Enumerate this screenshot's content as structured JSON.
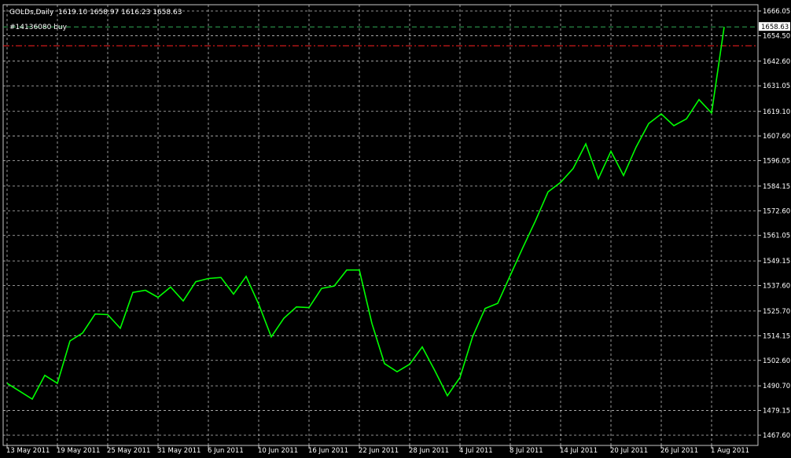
{
  "header": {
    "symbol_label": "GOLDs,Daily",
    "ohlc_text": "1619.10 1658.97 1616.23 1658.63",
    "order_label": "#14136080 buy"
  },
  "colors": {
    "background": "#000000",
    "grid": "#ffffff",
    "price_line": "#00ff00",
    "current_price_line": "#33aa55",
    "order_line": "#ff2020",
    "text": "#ffffff",
    "price_box_bg": "#ffffff",
    "price_box_text": "#000000"
  },
  "chart_data": {
    "type": "line",
    "current_price": 1658.63,
    "order_price": 1649.8,
    "ylim": [
      1467.6,
      1666.05
    ],
    "y_ticks": [
      1666.05,
      1654.5,
      1642.6,
      1631.05,
      1619.1,
      1607.6,
      1596.05,
      1584.15,
      1572.6,
      1561.05,
      1549.15,
      1537.6,
      1525.7,
      1514.15,
      1502.6,
      1490.7,
      1479.15,
      1467.6
    ],
    "y_tick_labels": [
      "1666.05",
      "1654.50",
      "1642.60",
      "1631.05",
      "1619.10",
      "1607.60",
      "1596.05",
      "1584.15",
      "1572.60",
      "1561.05",
      "1549.15",
      "1537.60",
      "1525.70",
      "1514.15",
      "1502.60",
      "1490.70",
      "1479.15",
      "1467.60"
    ],
    "x_labels": [
      {
        "i": 0,
        "label": "13 May 2011"
      },
      {
        "i": 4,
        "label": "19 May 2011"
      },
      {
        "i": 8,
        "label": "25 May 2011"
      },
      {
        "i": 12,
        "label": "31 May 2011"
      },
      {
        "i": 16,
        "label": "6 Jun 2011"
      },
      {
        "i": 20,
        "label": "10 Jun 2011"
      },
      {
        "i": 24,
        "label": "16 Jun 2011"
      },
      {
        "i": 28,
        "label": "22 Jun 2011"
      },
      {
        "i": 32,
        "label": "28 Jun 2011"
      },
      {
        "i": 36,
        "label": "4 Jul 2011"
      },
      {
        "i": 40,
        "label": "8 Jul 2011"
      },
      {
        "i": 44,
        "label": "14 Jul 2011"
      },
      {
        "i": 48,
        "label": "20 Jul 2011"
      },
      {
        "i": 52,
        "label": "26 Jul 2011"
      },
      {
        "i": 56,
        "label": "1 Aug 2011"
      }
    ],
    "values": [
      1491.9,
      1488.2,
      1484.5,
      1495.6,
      1491.9,
      1511.7,
      1515.4,
      1524.3,
      1524.0,
      1517.6,
      1534.4,
      1535.4,
      1532.1,
      1536.9,
      1530.4,
      1539.4,
      1540.9,
      1541.4,
      1533.6,
      1541.9,
      1528.9,
      1513.6,
      1522.3,
      1527.6,
      1527.3,
      1536.3,
      1537.4,
      1544.9,
      1544.9,
      1519.9,
      1501.1,
      1497.3,
      1500.8,
      1508.9,
      1497.8,
      1486.1,
      1494.6,
      1513.6,
      1526.9,
      1529.3,
      1542.4,
      1555.4,
      1567.9,
      1581.4,
      1585.9,
      1592.4,
      1603.9,
      1587.6,
      1600.4,
      1589.1,
      1602.4,
      1613.4,
      1617.9,
      1612.4,
      1615.6,
      1624.6,
      1618.3,
      1658.63
    ],
    "grid": true,
    "grid_style": "dashed"
  }
}
